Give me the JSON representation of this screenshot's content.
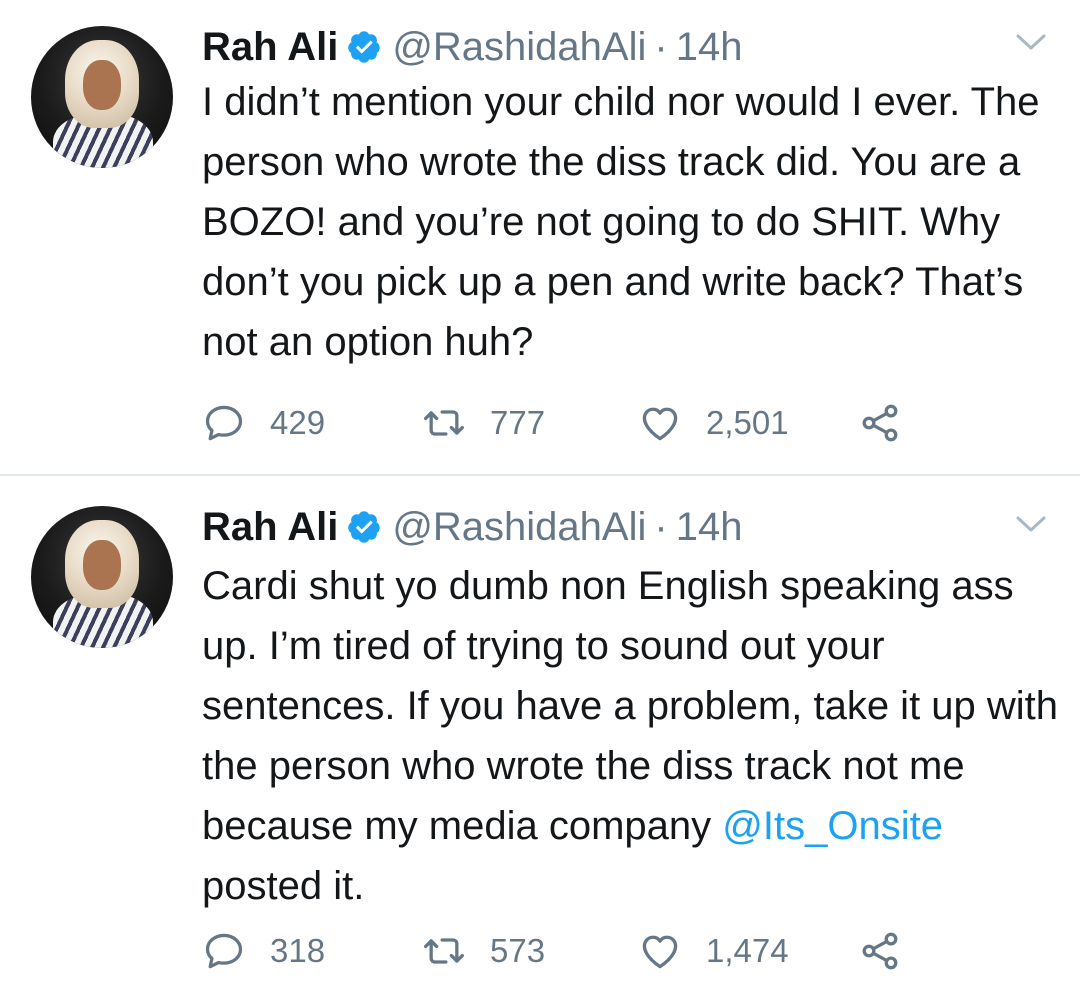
{
  "tweets": [
    {
      "author_name": "Rah Ali",
      "handle": "@RashidahAli",
      "separator": "·",
      "time": "14h",
      "text_parts": [
        "I didn’t mention your child nor would I ever. The person who wrote the diss track did. You are a BOZO! and you’re not going to do SHIT. Why don’t you pick up a pen and write back? That’s not an option huh?"
      ],
      "replies": "429",
      "retweets": "777",
      "likes": "2,501"
    },
    {
      "author_name": "Rah Ali",
      "handle": "@RashidahAli",
      "separator": "·",
      "time": "14h",
      "text_parts": [
        "Cardi shut yo dumb non English speaking ass up. I’m tired of trying to sound out your sentences. If you have a problem, take it up with the person who wrote the diss track not me because my media company ",
        "@Its_Onsite",
        " posted it."
      ],
      "replies": "318",
      "retweets": "573",
      "likes": "1,474"
    }
  ],
  "icons": {
    "verified": "verified-badge-icon",
    "caret": "chevron-down-icon",
    "reply": "reply-icon",
    "retweet": "retweet-icon",
    "like": "heart-icon",
    "share": "share-icon"
  },
  "colors": {
    "text": "#14171a",
    "secondary": "#657786",
    "accent": "#1da1f2",
    "divider": "#e1e8ed"
  }
}
